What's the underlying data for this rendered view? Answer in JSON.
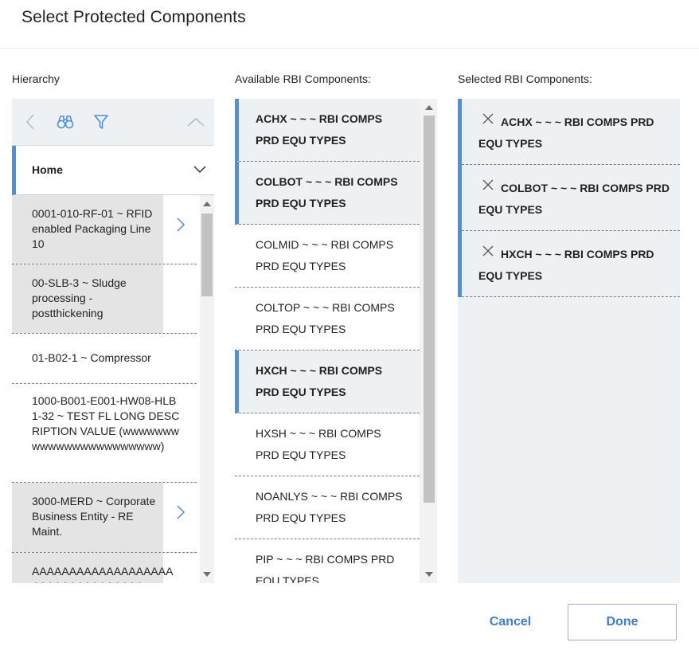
{
  "dialog": {
    "title": "Select Protected Components"
  },
  "hierarchy": {
    "label": "Hierarchy",
    "home_label": "Home",
    "items": [
      {
        "text": "0001-010-RF-01 ~ RFID enabled Packaging Line 10",
        "has_children": true
      },
      {
        "text": "00-SLB-3 ~ Sludge processing - postthickening",
        "has_children": false
      },
      {
        "text": "01-B02-1 ~ Compressor",
        "has_children": false
      },
      {
        "text": "1000-B001-E001-HW08-HLB1-32 ~ TEST FL LONG DESCRIPTION VALUE (wwwwwwwwwwwwwwwwwwwwwww)",
        "has_children": false
      },
      {
        "text": "3000-MERD ~ Corporate Business Entity - RE Maint.",
        "has_children": true
      },
      {
        "text": "AAAAAAAAAAAAAAAAAAAAAAAAAAAAAAAAAA",
        "has_children": false
      }
    ]
  },
  "available": {
    "label": "Available RBI Components:",
    "items": [
      {
        "text": "ACHX ~ ~ ~ RBI COMPS PRD EQU TYPES",
        "selected": true
      },
      {
        "text": "COLBOT ~ ~ ~ RBI COMPS PRD EQU TYPES",
        "selected": true
      },
      {
        "text": "COLMID ~ ~ ~ RBI COMPS PRD EQU TYPES",
        "selected": false
      },
      {
        "text": "COLTOP ~ ~ ~ RBI COMPS PRD EQU TYPES",
        "selected": false
      },
      {
        "text": "HXCH ~ ~ ~ RBI COMPS PRD EQU TYPES",
        "selected": true
      },
      {
        "text": "HXSH ~ ~ ~ RBI COMPS PRD EQU TYPES",
        "selected": false
      },
      {
        "text": "NOANLYS ~ ~ ~ RBI COMPS PRD EQU TYPES",
        "selected": false
      },
      {
        "text": "PIP ~ ~ ~ RBI COMPS PRD EQU TYPES",
        "selected": false
      }
    ]
  },
  "selected": {
    "label": "Selected RBI Components:",
    "items": [
      {
        "text": "ACHX ~ ~ ~ RBI COMPS PRD EQU TYPES"
      },
      {
        "text": "COLBOT ~ ~ ~ RBI COMPS PRD EQU TYPES"
      },
      {
        "text": "HXCH ~ ~ ~ RBI COMPS PRD EQU TYPES"
      }
    ]
  },
  "footer": {
    "cancel_label": "Cancel",
    "done_label": "Done"
  },
  "icons": {
    "toolbar": [
      "chevron-left-icon",
      "binoculars-icon",
      "filter-icon",
      "chevron-up-icon"
    ],
    "home": "chevron-down-icon",
    "remove": "close-icon",
    "drill": "chevron-right-icon"
  },
  "colors": {
    "accent": "#4a90e2",
    "link": "#3c7ed6",
    "panel_bg": "#eef1f4",
    "item_shade": "#e4e4e4"
  }
}
